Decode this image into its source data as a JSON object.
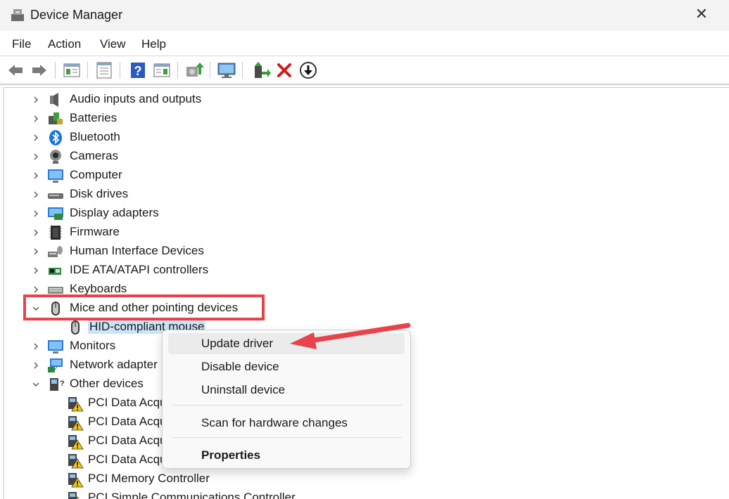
{
  "window": {
    "title": "Device Manager",
    "close_glyph": "✕"
  },
  "menu": {
    "file": "File",
    "action": "Action",
    "view": "View",
    "help": "Help"
  },
  "toolbar": {
    "buttons": [
      "back-icon",
      "forward-icon",
      "show-hide-tree-icon",
      "properties-icon",
      "help-icon",
      "action-pane-icon",
      "update-driver-icon",
      "scan-monitor-icon",
      "add-driver-icon",
      "uninstall-icon",
      "download-icon"
    ]
  },
  "tree": {
    "items": [
      {
        "label": "Audio inputs and outputs",
        "icon": "speaker-icon",
        "expanded": false
      },
      {
        "label": "Batteries",
        "icon": "battery-icon",
        "expanded": false
      },
      {
        "label": "Bluetooth",
        "icon": "bluetooth-icon",
        "expanded": false
      },
      {
        "label": "Cameras",
        "icon": "camera-icon",
        "expanded": false
      },
      {
        "label": "Computer",
        "icon": "computer-icon",
        "expanded": false
      },
      {
        "label": "Disk drives",
        "icon": "disk-drive-icon",
        "expanded": false
      },
      {
        "label": "Display adapters",
        "icon": "display-adapter-icon",
        "expanded": false
      },
      {
        "label": "Firmware",
        "icon": "firmware-icon",
        "expanded": false
      },
      {
        "label": "Human Interface Devices",
        "icon": "hid-icon",
        "expanded": false
      },
      {
        "label": "IDE ATA/ATAPI controllers",
        "icon": "ide-controller-icon",
        "expanded": false
      },
      {
        "label": "Keyboards",
        "icon": "keyboard-icon",
        "expanded": false
      },
      {
        "label": "Mice and other pointing devices",
        "icon": "mouse-icon",
        "expanded": true
      },
      {
        "label": "HID-compliant mouse",
        "icon": "mouse-icon",
        "child": true,
        "selected": true
      },
      {
        "label": "Monitors",
        "icon": "monitor-icon",
        "expanded": false
      },
      {
        "label": "Network adapter",
        "icon": "network-adapter-icon",
        "expanded": false
      },
      {
        "label": "Other devices",
        "icon": "unknown-device-icon",
        "expanded": true
      },
      {
        "label": "PCI Data Acqu",
        "icon": "warning-device-icon",
        "child": true
      },
      {
        "label": "PCI Data Acqu",
        "icon": "warning-device-icon",
        "child": true
      },
      {
        "label": "PCI Data Acqu",
        "icon": "warning-device-icon",
        "child": true
      },
      {
        "label": "PCI Data Acqu",
        "icon": "warning-device-icon",
        "child": true
      },
      {
        "label": "PCI Memory Controller",
        "icon": "warning-device-icon",
        "child": true
      },
      {
        "label": "PCI Simple Communications Controller",
        "icon": "warning-device-icon",
        "child": true
      }
    ]
  },
  "context_menu": {
    "update_driver": "Update driver",
    "disable_device": "Disable device",
    "uninstall_device": "Uninstall device",
    "scan_hardware": "Scan for hardware changes",
    "properties": "Properties"
  },
  "colors": {
    "annotation_red": "#e8424a",
    "selection_blue": "#cce4f7"
  }
}
